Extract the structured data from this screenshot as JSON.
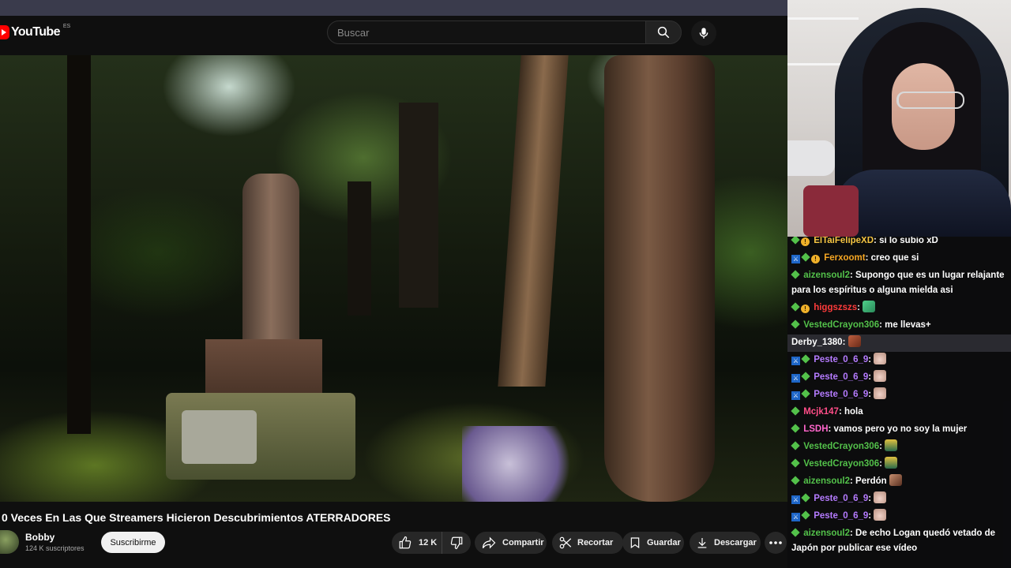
{
  "youtube": {
    "logo_text": "YouTube",
    "country_code": "ES",
    "search_placeholder": "Buscar",
    "video_title": "0 Veces En Las Que Streamers Hicieron Descubrimientos ATERRADORES",
    "channel": {
      "name": "Bobby",
      "subscribers": "124 K suscriptores",
      "subscribe_label": "Suscribirme"
    },
    "actions": {
      "like_count": "12 K",
      "share_label": "Compartir",
      "clip_label": "Recortar",
      "save_label": "Guardar",
      "download_label": "Descargar"
    }
  },
  "chat": {
    "messages": [
      {
        "user": "ElTaiFelipeXD",
        "user_color": "#f5c542",
        "text": "si lo subio xD"
      },
      {
        "user": "Ferxoomt",
        "user_color": "#f5a623",
        "text": "creo que si"
      },
      {
        "user": "aizensoul2",
        "user_color": "#53c14a",
        "text": "Supongo que es un lugar relajante para los espíritus o alguna mielda asi"
      },
      {
        "user": "higgszszs",
        "user_color": "#ff3b3b",
        "text": ""
      },
      {
        "user": "VestedCrayon306",
        "user_color": "#53c14a",
        "text": "me llevas+"
      },
      {
        "user": "Derby_1380",
        "user_color": "#ffffff",
        "text": ""
      },
      {
        "user": "Peste_0_6_9",
        "user_color": "#b57bff",
        "text": ""
      },
      {
        "user": "Peste_0_6_9",
        "user_color": "#b57bff",
        "text": ""
      },
      {
        "user": "Peste_0_6_9",
        "user_color": "#b57bff",
        "text": ""
      },
      {
        "user": "Mcjk147",
        "user_color": "#ff4d88",
        "text": "hola"
      },
      {
        "user": "LSDH",
        "user_color": "#ff66cc",
        "text": "vamos pero yo no soy la mujer"
      },
      {
        "user": "VestedCrayon306",
        "user_color": "#53c14a",
        "text": ""
      },
      {
        "user": "VestedCrayon306",
        "user_color": "#53c14a",
        "text": ""
      },
      {
        "user": "aizensoul2",
        "user_color": "#53c14a",
        "text": "Perdón"
      },
      {
        "user": "Peste_0_6_9",
        "user_color": "#b57bff",
        "text": ""
      },
      {
        "user": "Peste_0_6_9",
        "user_color": "#b57bff",
        "text": ""
      },
      {
        "user": "aizensoul2",
        "user_color": "#53c14a",
        "text": "De echo Logan quedó vetado de Japón por publicar ese vídeo"
      }
    ]
  }
}
